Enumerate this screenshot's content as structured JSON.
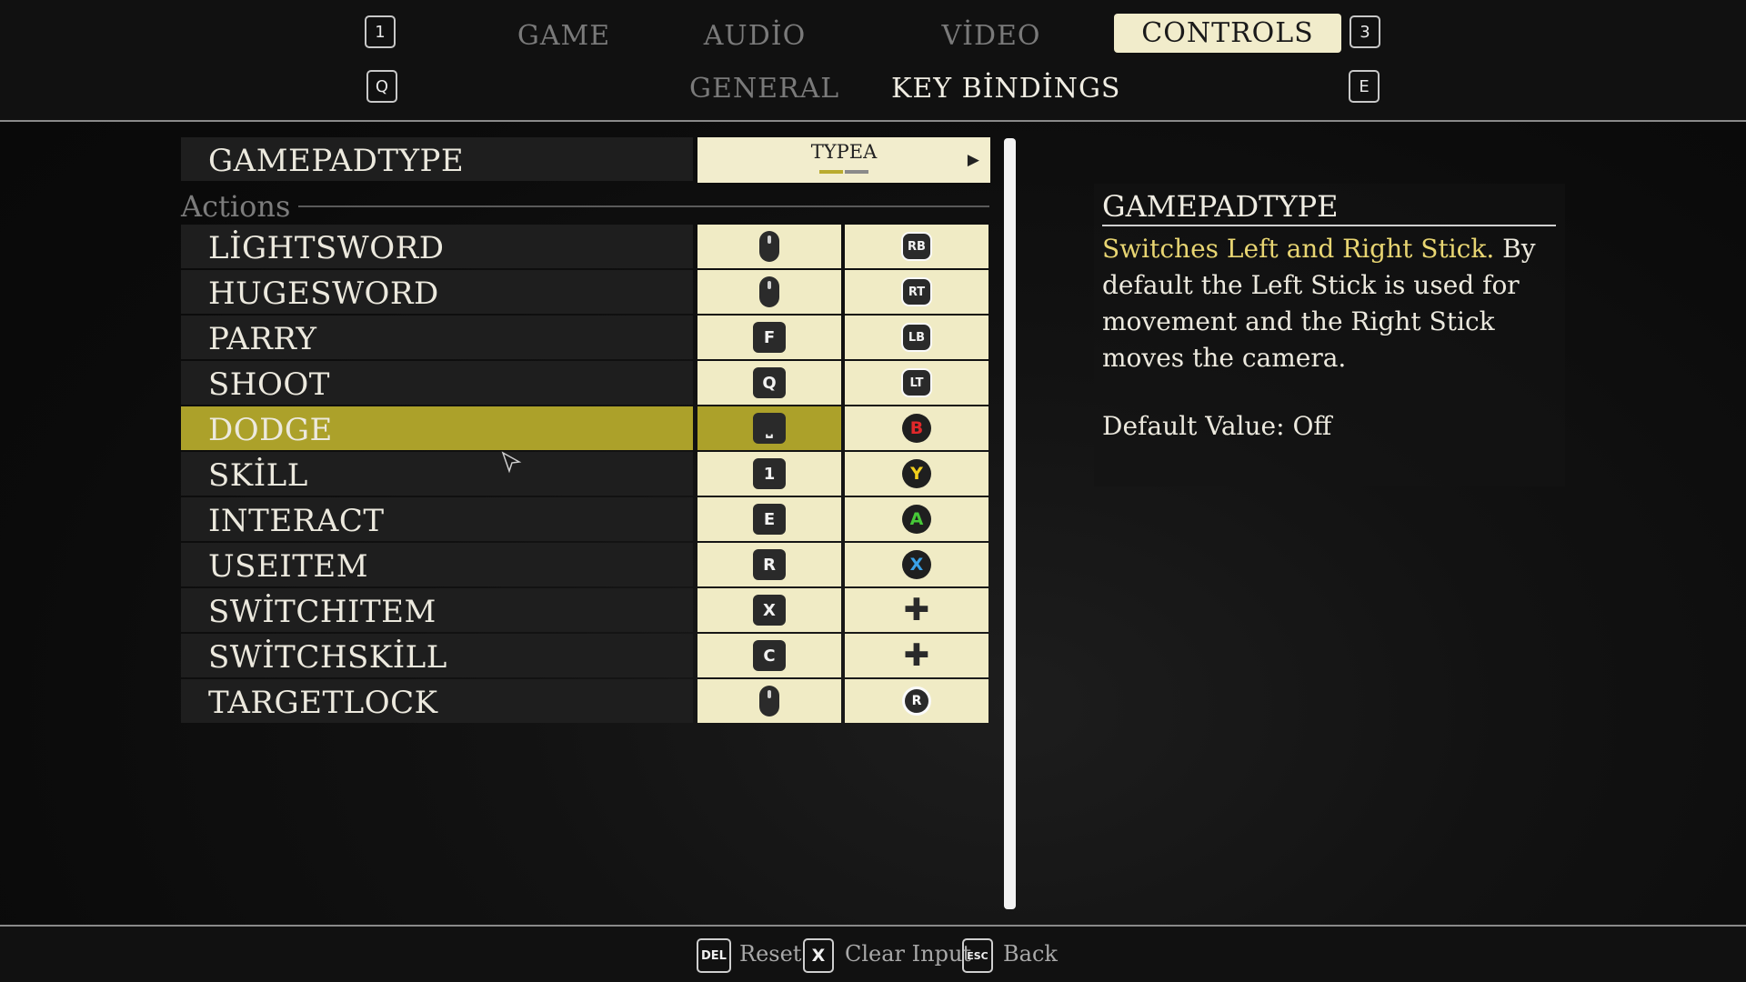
{
  "header": {
    "main_tabs": [
      {
        "label": "GAME",
        "active": false
      },
      {
        "label": "AUDİO",
        "active": false
      },
      {
        "label": "VİDEO",
        "active": false
      },
      {
        "label": "CONTROLS",
        "active": true
      }
    ],
    "sub_tabs": [
      {
        "label": "GENERAL",
        "active": false
      },
      {
        "label": "KEY BİNDİNGS",
        "active": true
      }
    ],
    "prev_tab_key": "1",
    "next_tab_key": "3",
    "prev_subtab_key": "Q",
    "next_subtab_key": "E"
  },
  "gamepad_type": {
    "label": "GAMEPADTYPE",
    "value": "TYPEA",
    "arrow": "▶"
  },
  "actions_section_label": "Actions",
  "actions": [
    {
      "label": "LİGHTSWORD",
      "keyboard": "mouse-left",
      "gamepad": "RB",
      "selected": false
    },
    {
      "label": "HUGESWORD",
      "keyboard": "mouse-right",
      "gamepad": "RT",
      "selected": false
    },
    {
      "label": "PARRY",
      "keyboard": "F",
      "gamepad": "LB",
      "selected": false
    },
    {
      "label": "SHOOT",
      "keyboard": "Q",
      "gamepad": "LT",
      "selected": false
    },
    {
      "label": "DODGE",
      "keyboard": "⎵",
      "gamepad": "B",
      "selected": true
    },
    {
      "label": "SKİLL",
      "keyboard": "1",
      "gamepad": "Y",
      "selected": false
    },
    {
      "label": "INTERACT",
      "keyboard": "E",
      "gamepad": "A",
      "selected": false
    },
    {
      "label": "USEITEM",
      "keyboard": "R",
      "gamepad": "X",
      "selected": false
    },
    {
      "label": "SWİTCHITEM",
      "keyboard": "X",
      "gamepad": "dpad",
      "selected": false
    },
    {
      "label": "SWİTCHSKİLL",
      "keyboard": "C",
      "gamepad": "dpad",
      "selected": false
    },
    {
      "label": "TARGETLOCK",
      "keyboard": "mouse-middle",
      "gamepad": "R",
      "selected": false
    }
  ],
  "face_button_colors": {
    "B": "#e0282a",
    "Y": "#f2cf1d",
    "A": "#46c838",
    "X": "#3aa2e8"
  },
  "description": {
    "title": "GAMEPADTYPE",
    "highlight": "Switches Left and Right Stick.",
    "body": " By default the Left Stick is used for movement and the Right Stick moves the camera.",
    "default_value": "Default Value: Off"
  },
  "footer": {
    "reset_key": "DEL",
    "reset_label": "Reset",
    "clear_key": "X",
    "clear_label": "Clear Input",
    "back_key": "ESC",
    "back_label": "Back"
  }
}
